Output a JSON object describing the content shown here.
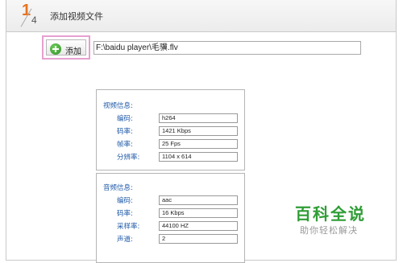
{
  "header": {
    "step_current": "1",
    "step_total": "4",
    "title": "添加视频文件"
  },
  "toolbar": {
    "add_label": "添加",
    "file_path": "F:\\baidu player\\毛骥.flv"
  },
  "video_info": {
    "heading": "视频信息:",
    "fields": [
      {
        "label": "编码:",
        "value": "h264"
      },
      {
        "label": "码率:",
        "value": "1421 Kbps"
      },
      {
        "label": "帧率:",
        "value": "25 Fps"
      },
      {
        "label": "分辨率:",
        "value": "1104 x 614"
      }
    ]
  },
  "audio_info": {
    "heading": "音频信息:",
    "fields": [
      {
        "label": "编码:",
        "value": "aac"
      },
      {
        "label": "码率:",
        "value": "16 Kbps"
      },
      {
        "label": "采样率:",
        "value": "44100 HZ"
      },
      {
        "label": "声道:",
        "value": "2"
      }
    ]
  },
  "watermark": {
    "title": "百科全说",
    "subtitle": "助你轻松解决"
  },
  "colors": {
    "accent": "#e8731f",
    "label_blue": "#1f5aa8",
    "brand_green": "#2f9d35",
    "highlight_pink": "#e6a0cf"
  }
}
